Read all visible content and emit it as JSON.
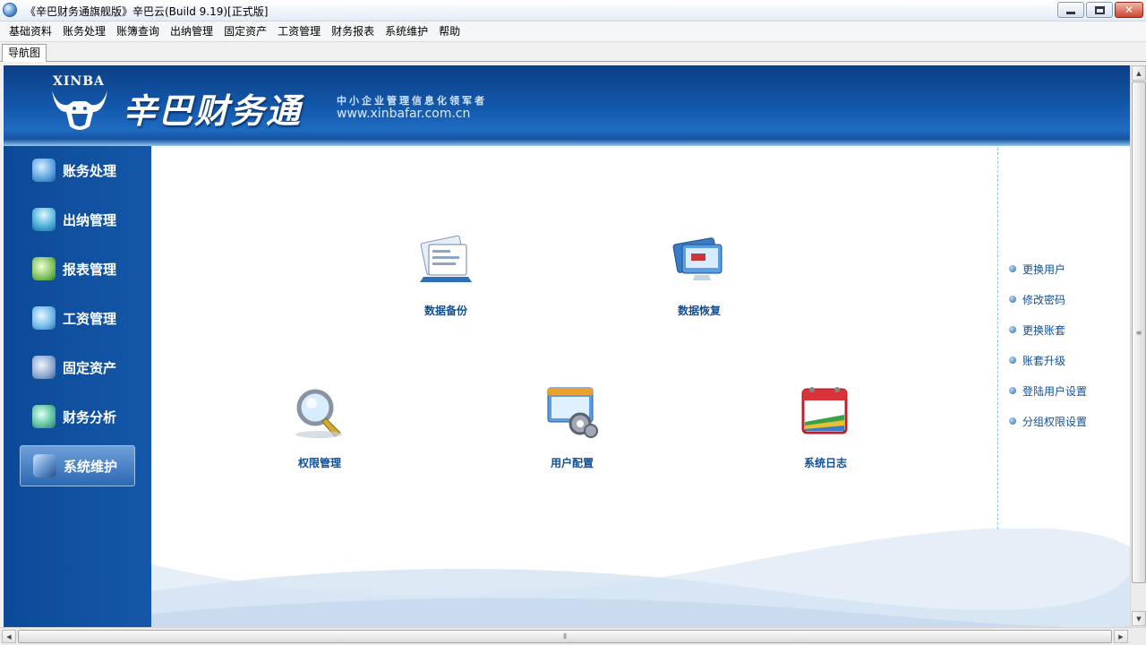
{
  "window": {
    "title": "《辛巴财务通旗舰版》辛巴云(Build 9.19)[正式版]",
    "minimize_glyph": "",
    "close_glyph": "✕"
  },
  "menu": [
    "基础资料",
    "账务处理",
    "账簿查询",
    "出纳管理",
    "固定资产",
    "工资管理",
    "财务报表",
    "系统维护",
    "帮助"
  ],
  "tabs": [
    {
      "label": "导航图"
    }
  ],
  "banner": {
    "logo_text": "XINBA",
    "brand_name": "辛巴财务通",
    "slogan": "中小企业管理信息化领军者",
    "url": "www.xinbafar.com.cn"
  },
  "side_nav": [
    {
      "label": "账务处理",
      "icon": "accounting-icon",
      "color": "#5aa0e0",
      "active": false
    },
    {
      "label": "出纳管理",
      "icon": "cashier-icon",
      "color": "#4ab0d8",
      "active": false
    },
    {
      "label": "报表管理",
      "icon": "report-icon",
      "color": "#7cc05a",
      "active": false
    },
    {
      "label": "工资管理",
      "icon": "salary-icon",
      "color": "#6cb8e8",
      "active": false
    },
    {
      "label": "固定资产",
      "icon": "asset-icon",
      "color": "#8aa8d0",
      "active": false
    },
    {
      "label": "财务分析",
      "icon": "analysis-icon",
      "color": "#58c0a0",
      "active": false
    },
    {
      "label": "系统维护",
      "icon": "maintenance-icon",
      "color": "#5a8cc8",
      "active": true
    }
  ],
  "tiles": [
    {
      "label": "数据备份",
      "icon": "data-backup-icon"
    },
    {
      "label": "数据恢复",
      "icon": "data-restore-icon"
    },
    {
      "label": "权限管理",
      "icon": "permission-icon"
    },
    {
      "label": "用户配置",
      "icon": "user-config-icon"
    },
    {
      "label": "系统日志",
      "icon": "system-log-icon"
    }
  ],
  "right_links": [
    "更换用户",
    "修改密码",
    "更换账套",
    "账套升级",
    "登陆用户设置",
    "分组权限设置"
  ],
  "colors": {
    "banner": "#155aae",
    "nav": "#0c4a98",
    "link": "#0f4f96"
  }
}
